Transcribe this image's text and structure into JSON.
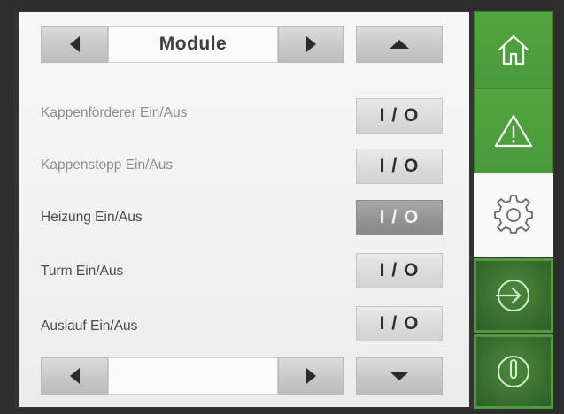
{
  "header": {
    "title": "Module"
  },
  "rows": [
    {
      "label": "Kappenförderer Ein/Aus",
      "toggle": "I / O",
      "active": false,
      "label_color": "#8d8d8d"
    },
    {
      "label": "Kappenstopp Ein/Aus",
      "toggle": "I / O",
      "active": false,
      "label_color": "#8d8d8d"
    },
    {
      "label": "Heizung Ein/Aus",
      "toggle": "I / O",
      "active": true,
      "label_color": "#4a4a4a"
    },
    {
      "label": "Turm Ein/Aus",
      "toggle": "I / O",
      "active": false,
      "label_color": "#4a4a4a"
    },
    {
      "label": "Auslauf Ein/Aus",
      "toggle": "I / O",
      "active": false,
      "label_color": "#4a4a4a"
    }
  ],
  "sidebar": {
    "items": [
      {
        "icon": "home-icon",
        "style": "green"
      },
      {
        "icon": "warning-icon",
        "style": "green"
      },
      {
        "icon": "gear-icon",
        "style": "white",
        "selected": true
      },
      {
        "icon": "login-icon",
        "style": "dark-green"
      },
      {
        "icon": "power-icon",
        "style": "dark-green"
      }
    ]
  },
  "colors": {
    "accent_green": "#4a9a3a",
    "dark_green": "#3a6f2f",
    "panel_bg": "#f3f3f3",
    "frame": "#323432"
  }
}
